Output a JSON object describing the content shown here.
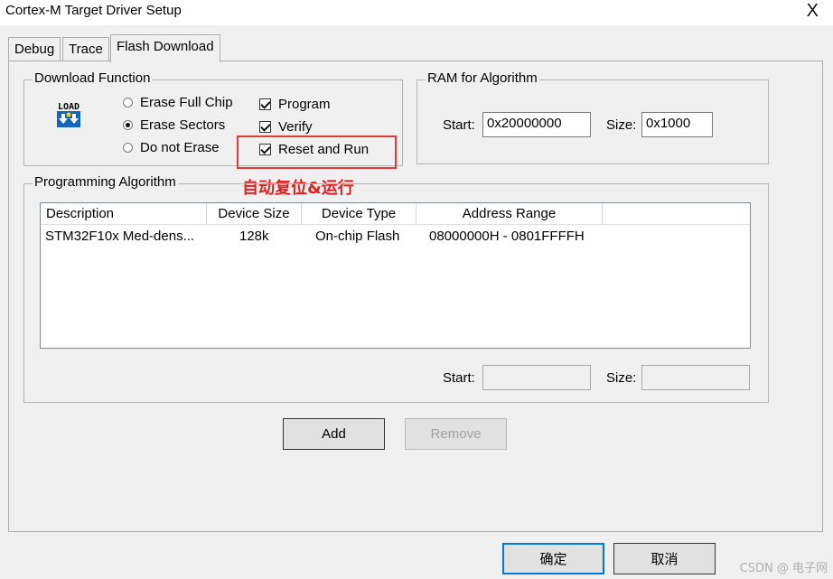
{
  "window": {
    "title": "Cortex-M Target Driver Setup",
    "close": "X"
  },
  "tabs": [
    {
      "label": "Debug"
    },
    {
      "label": "Trace"
    },
    {
      "label": "Flash Download",
      "active": true
    }
  ],
  "download_function": {
    "legend": "Download Function",
    "icon": "load-icon",
    "icon_text": "LOAD",
    "erase_options": [
      {
        "label": "Erase Full Chip",
        "selected": false
      },
      {
        "label": "Erase Sectors",
        "selected": true
      },
      {
        "label": "Do not Erase",
        "selected": false
      }
    ],
    "checks": [
      {
        "label": "Program",
        "checked": true
      },
      {
        "label": "Verify",
        "checked": true
      },
      {
        "label": "Reset and Run",
        "checked": true
      }
    ]
  },
  "ram": {
    "legend": "RAM for Algorithm",
    "start_label": "Start:",
    "start_value": "0x20000000",
    "size_label": "Size:",
    "size_value": "0x1000"
  },
  "annotation": {
    "text": "自动复位&运行",
    "color": "#e02020"
  },
  "programming": {
    "legend": "Programming Algorithm",
    "columns": [
      "Description",
      "Device Size",
      "Device Type",
      "Address Range"
    ],
    "rows": [
      [
        "STM32F10x Med-dens...",
        "128k",
        "On-chip Flash",
        "08000000H - 0801FFFFH"
      ]
    ],
    "start_label": "Start:",
    "start_value": "",
    "size_label": "Size:",
    "size_value": ""
  },
  "buttons": {
    "add": "Add",
    "remove": "Remove",
    "ok": "确定",
    "cancel": "取消"
  },
  "watermark": "CSDN @ 电子网"
}
